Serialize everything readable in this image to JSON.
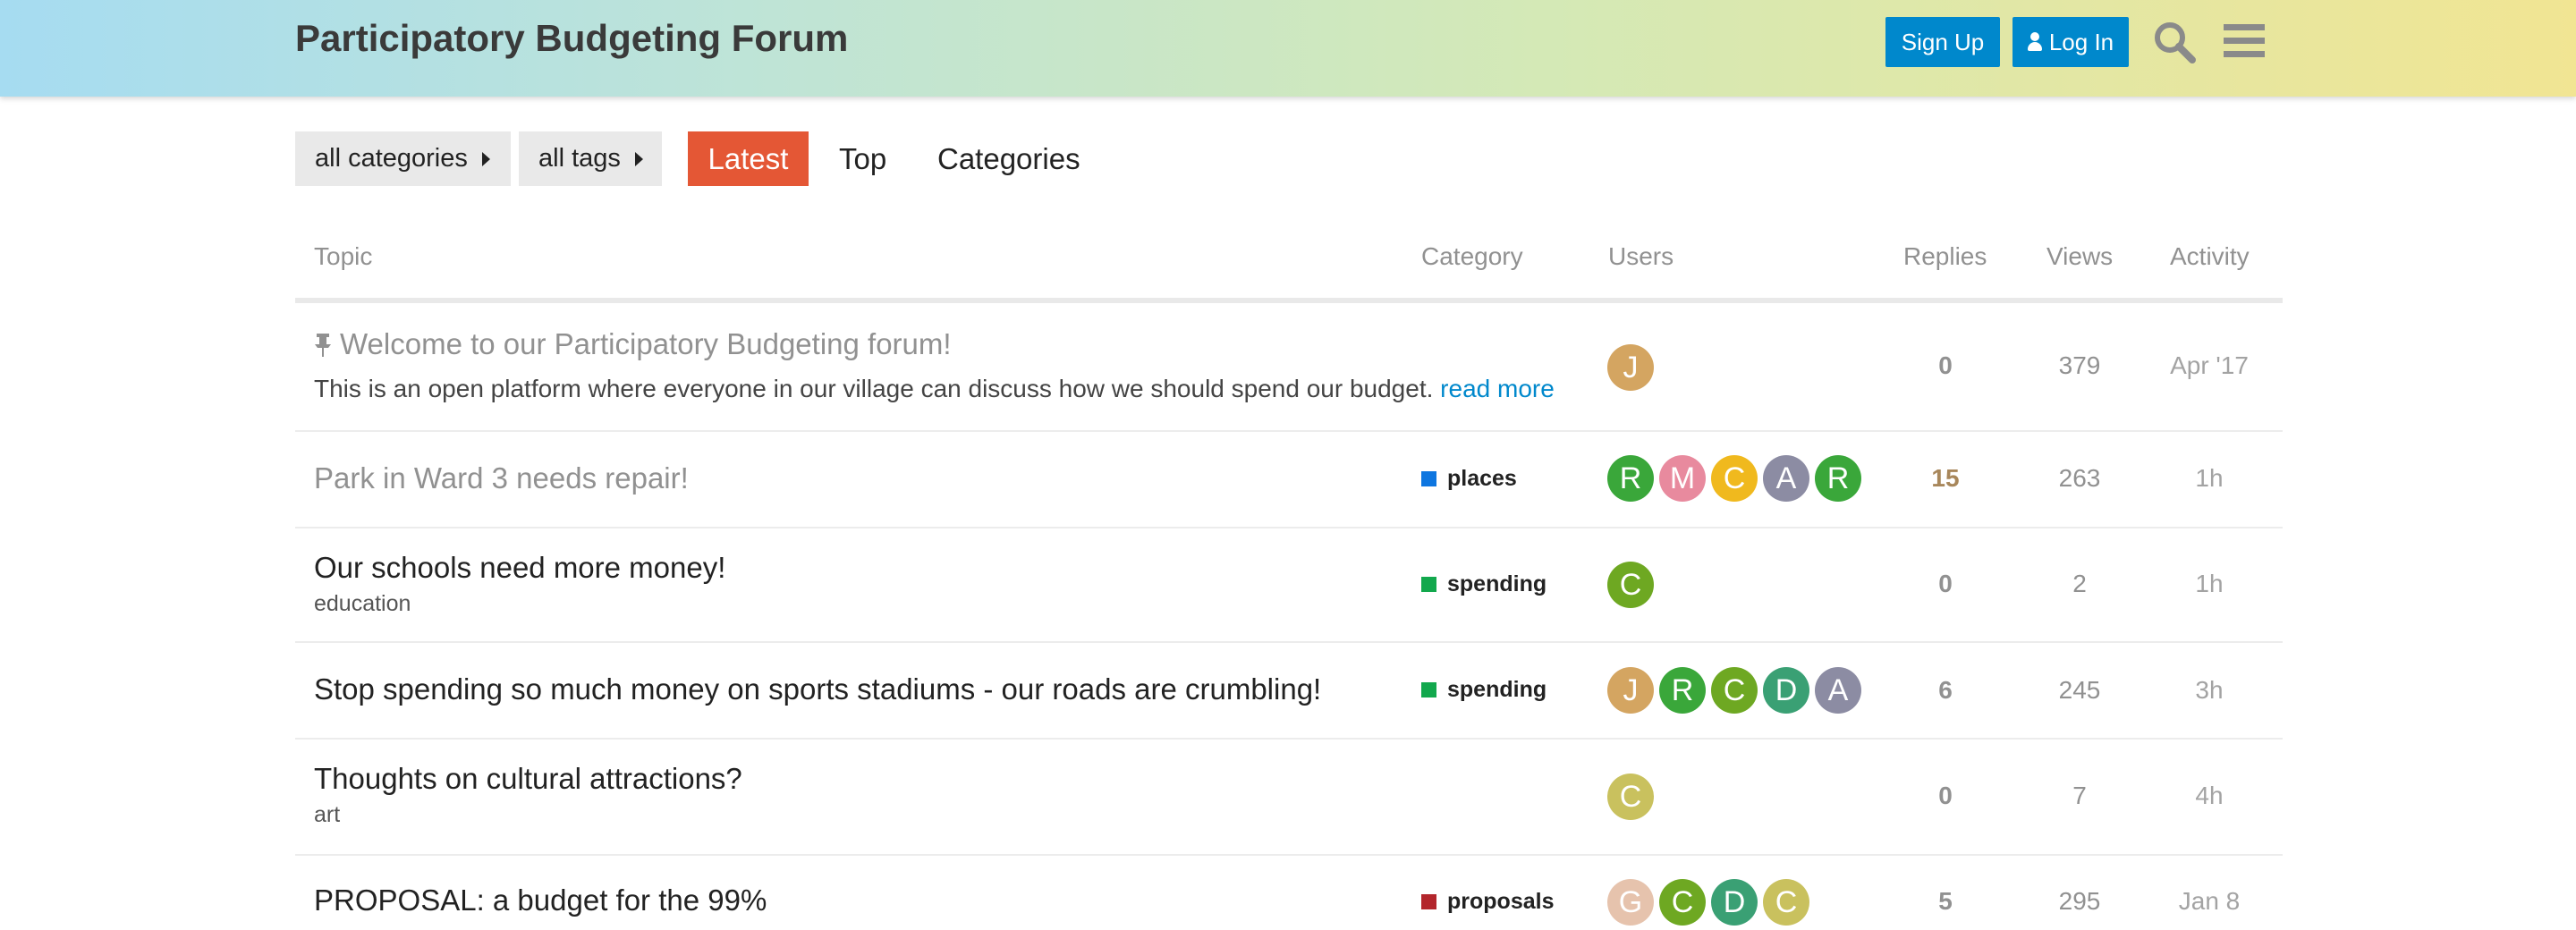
{
  "header": {
    "title": "Participatory Budgeting Forum",
    "signup_label": "Sign Up",
    "login_label": "Log In",
    "icons": [
      "person-icon",
      "search-icon",
      "menu-icon"
    ],
    "accent_color": "#0088cc"
  },
  "nav": {
    "categories_dropdown": "all categories",
    "tags_dropdown": "all tags",
    "tabs": [
      {
        "label": "Latest",
        "active": true
      },
      {
        "label": "Top",
        "active": false
      },
      {
        "label": "Categories",
        "active": false
      }
    ],
    "active_color": "#e45735"
  },
  "columns": [
    "Topic",
    "Category",
    "Users",
    "Replies",
    "Views",
    "Activity"
  ],
  "topics": [
    {
      "title": "Welcome to our Participatory Budgeting forum!",
      "pinned": true,
      "excerpt": "This is an open platform where everyone in our village can discuss how we should spend our budget.",
      "read_more": "read more",
      "category": "",
      "users": [
        {
          "letter": "J",
          "color": "#d4a561"
        }
      ],
      "replies": "0",
      "views": "379",
      "activity": "Apr '17"
    },
    {
      "title": "Park in Ward 3 needs repair!",
      "category": "places",
      "category_color": "#0e76e0",
      "users": [
        {
          "letter": "R",
          "color": "#3aa73a"
        },
        {
          "letter": "M",
          "color": "#e88a9e"
        },
        {
          "letter": "C",
          "color": "#f0b91e"
        },
        {
          "letter": "A",
          "color": "#8c8ca3"
        },
        {
          "letter": "R",
          "color": "#3aa73a"
        }
      ],
      "replies": "15",
      "views": "263",
      "activity": "1h"
    },
    {
      "title": "Our schools need more money!",
      "tag": "education",
      "category": "spending",
      "category_color": "#12a84d",
      "users": [
        {
          "letter": "C",
          "color": "#6ea822"
        }
      ],
      "replies": "0",
      "views": "2",
      "activity": "1h"
    },
    {
      "title": "Stop spending so much money on sports stadiums - our roads are crumbling!",
      "category": "spending",
      "category_color": "#12a84d",
      "users": [
        {
          "letter": "J",
          "color": "#d4a561"
        },
        {
          "letter": "R",
          "color": "#3aa73a"
        },
        {
          "letter": "C",
          "color": "#6ea822"
        },
        {
          "letter": "D",
          "color": "#3aa074"
        },
        {
          "letter": "A",
          "color": "#8c8ca3"
        }
      ],
      "replies": "6",
      "views": "245",
      "activity": "3h"
    },
    {
      "title": "Thoughts on cultural attractions?",
      "tag": "art",
      "category": "",
      "users": [
        {
          "letter": "C",
          "color": "#c9c15e"
        }
      ],
      "replies": "0",
      "views": "7",
      "activity": "4h"
    },
    {
      "title": "PROPOSAL: a budget for the 99%",
      "category": "proposals",
      "category_color": "#b3262c",
      "users": [
        {
          "letter": "G",
          "color": "#e6c3ad"
        },
        {
          "letter": "C",
          "color": "#6ea822"
        },
        {
          "letter": "D",
          "color": "#3aa074"
        },
        {
          "letter": "C",
          "color": "#c9c15e"
        }
      ],
      "replies": "5",
      "views": "295",
      "activity": "Jan 8"
    }
  ]
}
